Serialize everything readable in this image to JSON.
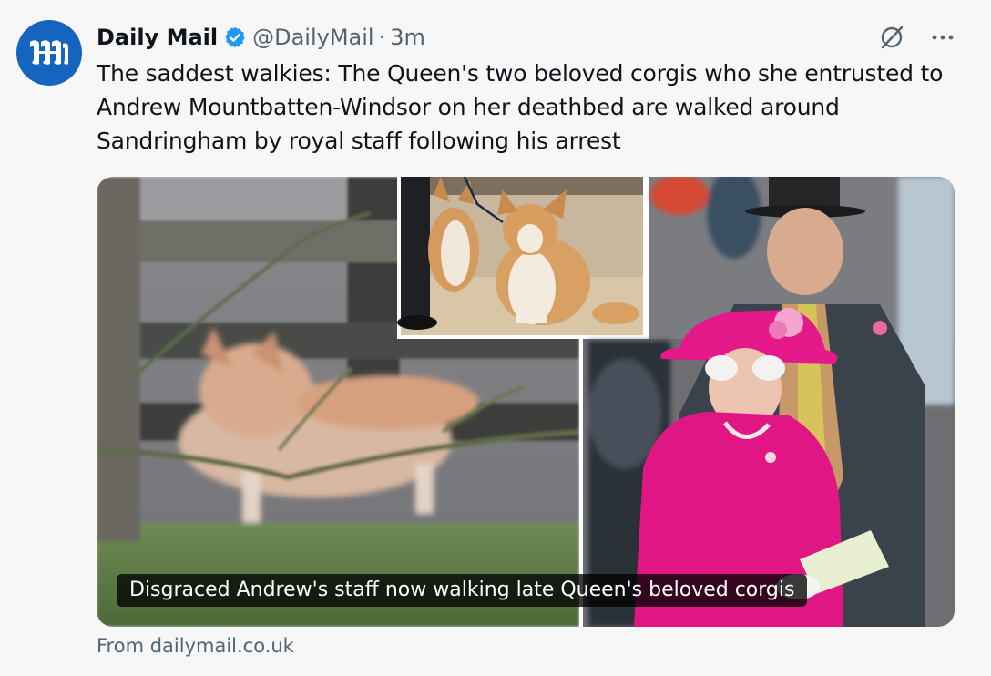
{
  "tweet": {
    "author_name": "Daily Mail",
    "handle": "@DailyMail",
    "separator": "·",
    "time": "3m",
    "text": "The saddest walkies: The Queen's two beloved corgis who she entrusted to Andrew Mountbatten-Windsor on her deathbed are walked around Sandringham by royal staff following his arrest"
  },
  "card": {
    "caption": "Disgraced Andrew's staff now walking late Queen's beloved corgis",
    "source": "From dailymail.co.uk"
  },
  "icons": {
    "avatar": "daily-mail-logo",
    "verified": "verified-badge-icon",
    "grok": "grok-icon",
    "more": "more-icon"
  },
  "colors": {
    "verified_blue": "#1d9bf0",
    "avatar_blue": "#1565c0",
    "secondary_text": "#536471",
    "caption_bg": "#000000c4"
  }
}
